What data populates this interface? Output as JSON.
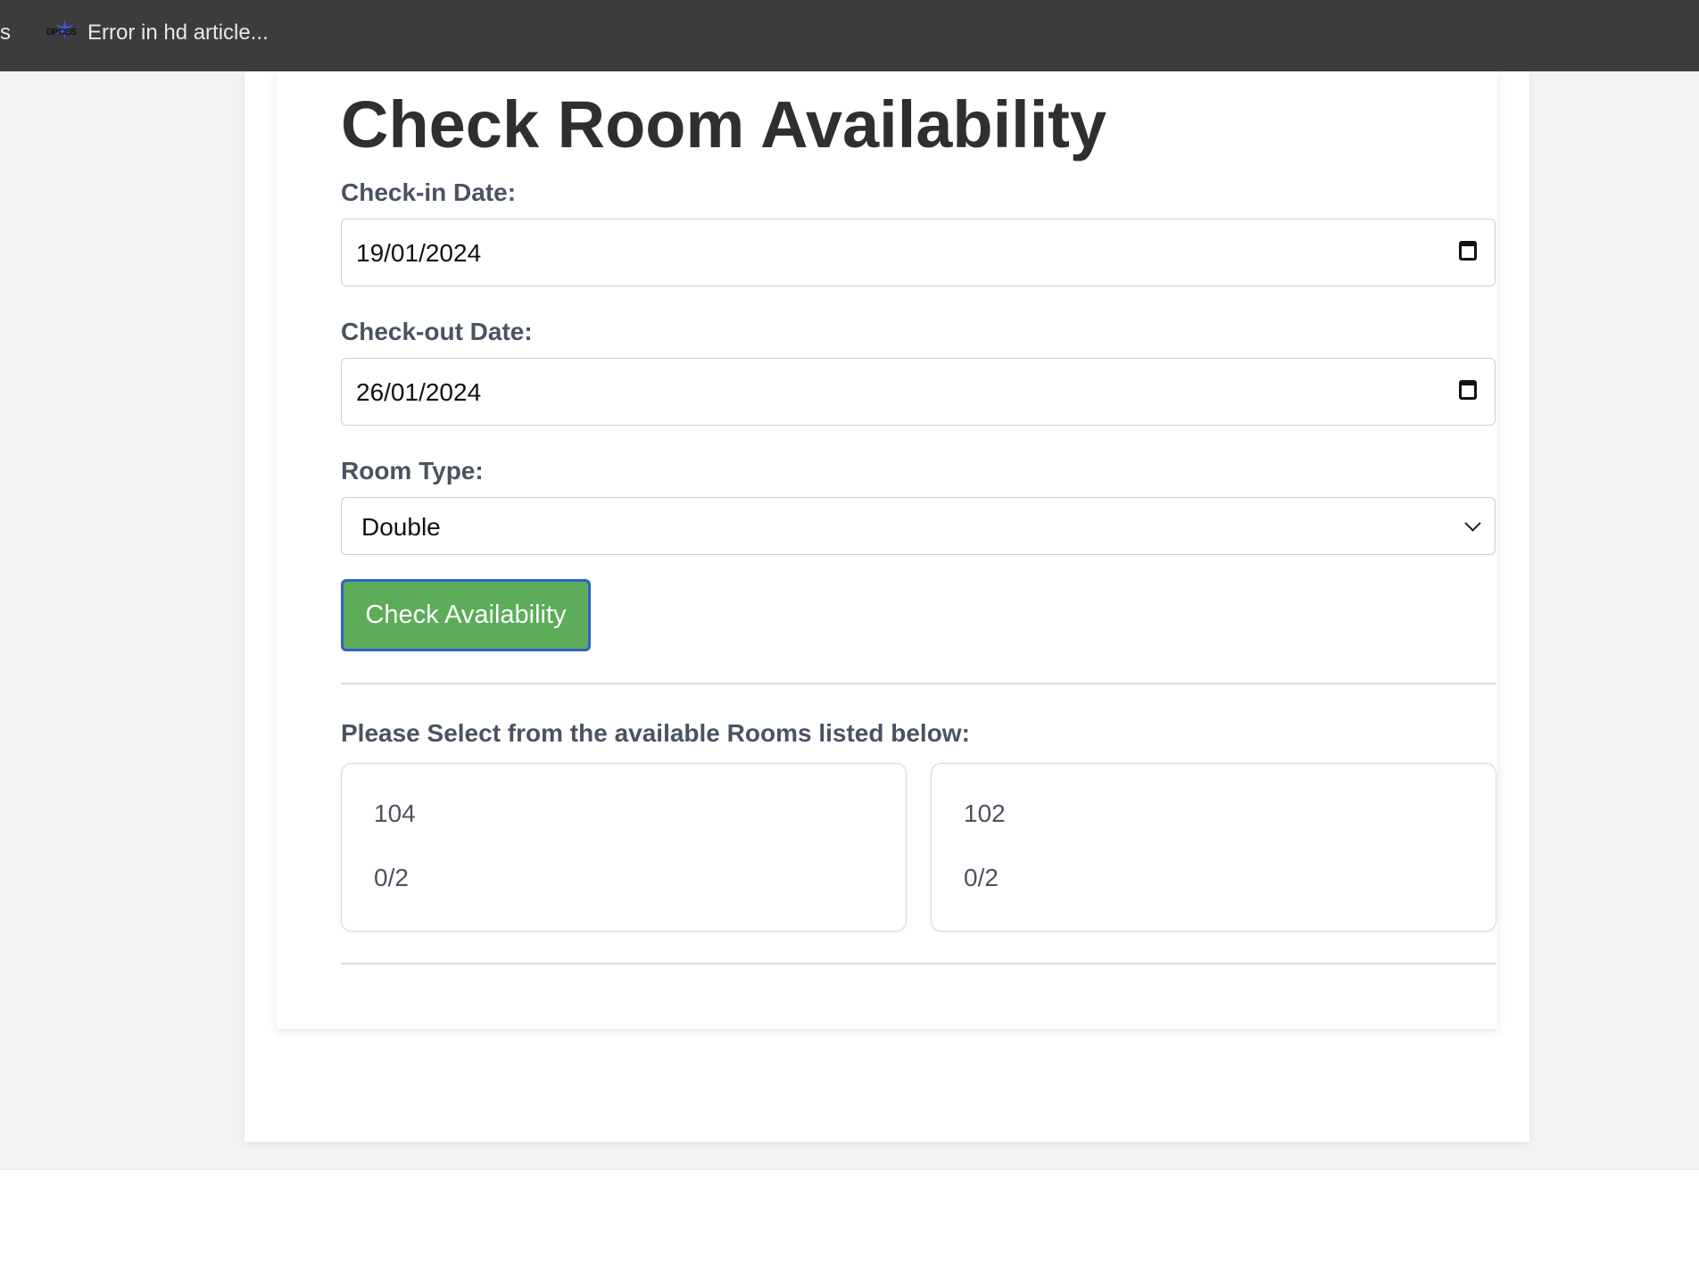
{
  "bookmarks_bar": {
    "partial_item_label": "s",
    "item": {
      "favicon": "star-logo-icon",
      "favicon_text": "DP CISS",
      "title": "Error in hd article..."
    }
  },
  "page": {
    "title": "Check Room Availability",
    "checkin": {
      "label": "Check-in Date:",
      "value": "19/01/2024"
    },
    "checkout": {
      "label": "Check-out Date:",
      "value": "26/01/2024"
    },
    "room_type": {
      "label": "Room Type:",
      "selected": "Double"
    },
    "check_button_label": "Check Availability",
    "rooms_heading": "Please Select from the available Rooms listed below:",
    "rooms": [
      {
        "number": "104",
        "occupancy": "0/2"
      },
      {
        "number": "102",
        "occupancy": "0/2"
      }
    ]
  },
  "colors": {
    "bookmarks_bar_bg": "#3c3c3c",
    "button_green": "#5cac5a",
    "button_focus_border": "#2f62c9",
    "label_text": "#4a5361",
    "title_text": "#2f2f2f"
  }
}
